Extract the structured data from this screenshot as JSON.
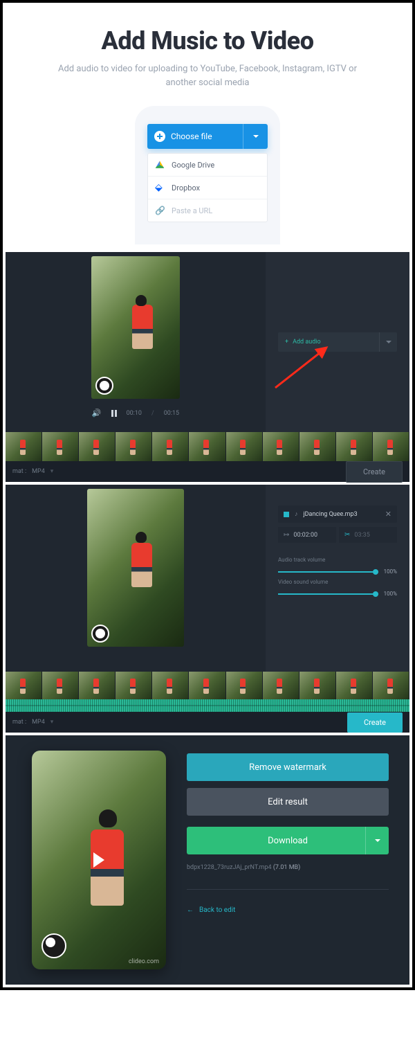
{
  "landing": {
    "title": "Add Music to Video",
    "subtitle": "Add audio to video for uploading to YouTube, Facebook, Instagram, IGTV or another social media",
    "choose_label": "Choose file",
    "options": {
      "gdrive": "Google Drive",
      "dropbox": "Dropbox",
      "url": "Paste a URL"
    }
  },
  "editor1": {
    "time_current": "00:10",
    "time_sep": "/",
    "time_total": "00:15",
    "add_audio": "Add audio",
    "format_label": "mat :",
    "format_value": "MP4",
    "create": "Create"
  },
  "editor2": {
    "file": "jDancing Quee.mp3",
    "start": "00:02:00",
    "end": "03:35",
    "audio_volume_label": "Audio track volume",
    "audio_volume": "100%",
    "video_volume_label": "Video sound volume",
    "video_volume": "100%",
    "format_label": "mat :",
    "format_value": "MP4",
    "create": "Create"
  },
  "result": {
    "remove_watermark": "Remove watermark",
    "edit_result": "Edit result",
    "download": "Download",
    "filename": "bdpx1228_73ruzJAj_prNT.mp4",
    "filesize": "(7.01 MB)",
    "back": "Back to edit",
    "wm_text": "clideo.com"
  }
}
